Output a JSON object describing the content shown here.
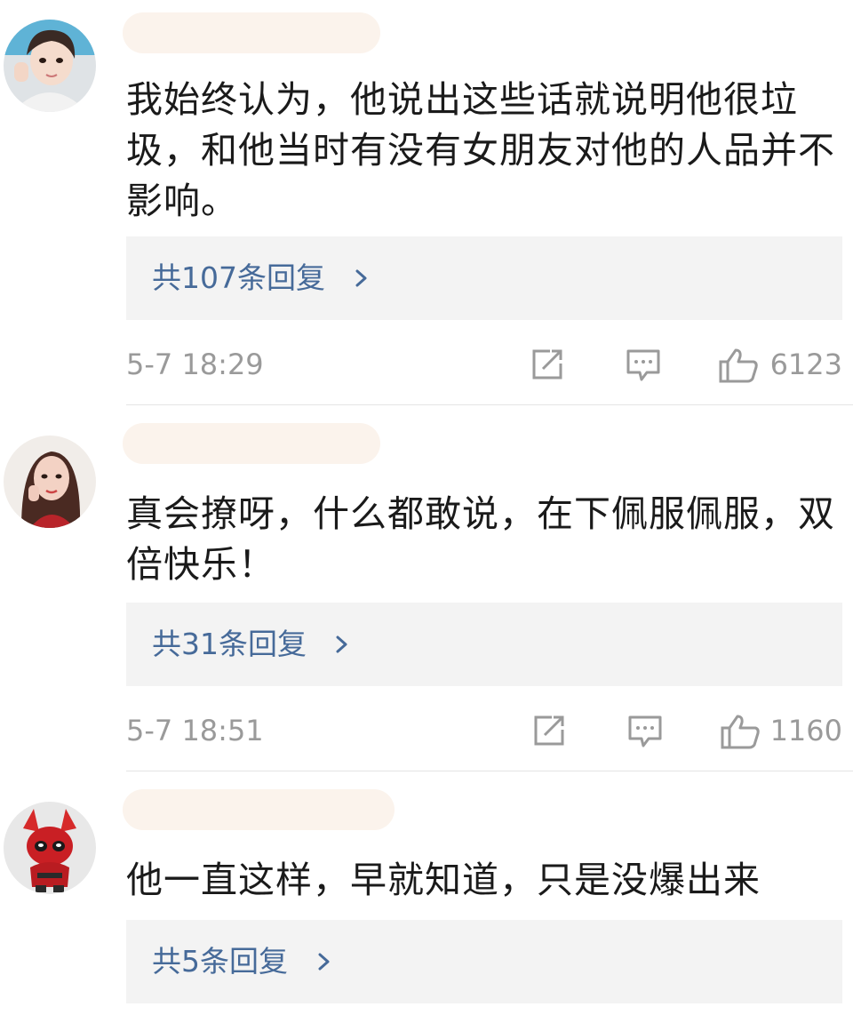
{
  "comments": [
    {
      "text": "我始终认为，他说出这些话就说明他很垃圾，和他当时有没有女朋友对他的人品并不影响。",
      "replies_label": "共107条回复",
      "timestamp": "5-7 18:29",
      "likes": "6123"
    },
    {
      "text": "真会撩呀，什么都敢说，在下佩服佩服，双倍快乐！",
      "replies_label": "共31条回复",
      "timestamp": "5-7 18:51",
      "likes": "1160"
    },
    {
      "text": "他一直这样，早就知道，只是没爆出来",
      "replies_label": "共5条回复"
    }
  ],
  "colors": {
    "link_blue": "#466a99",
    "meta_gray": "#9a9a9a",
    "reply_box_bg": "#f3f3f3",
    "text": "#1a1a1a"
  },
  "icons": {
    "repost": "share-square-icon",
    "comment": "comment-bubble-icon",
    "like": "thumbs-up-icon",
    "chevron": "chevron-right-icon"
  }
}
